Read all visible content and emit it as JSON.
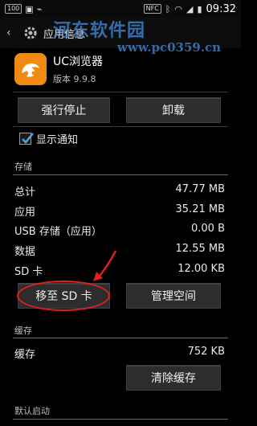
{
  "status_bar": {
    "left_badge": "100",
    "nfc": "NFC",
    "time": "09:32"
  },
  "watermark": {
    "text": "河东软件园",
    "url": "www.pc0359.cn"
  },
  "action_bar": {
    "title": "应用信息",
    "icons": [
      "back-icon",
      "settings-icon"
    ]
  },
  "app": {
    "name": "UC浏览器",
    "version": "版本 9.9.8",
    "icon": "uc-browser-icon",
    "icon_color": "#f08a12"
  },
  "buttons": {
    "force_stop": "强行停止",
    "uninstall": "卸载",
    "move_to_sd": "移至 SD 卡",
    "manage_space": "管理空间",
    "clear_cache": "清除缓存"
  },
  "notification": {
    "label": "显示通知",
    "checked": true
  },
  "storage": {
    "header": "存储",
    "rows": [
      {
        "label": "总计",
        "value": "47.77 MB"
      },
      {
        "label": "应用",
        "value": "35.21 MB"
      },
      {
        "label": "USB 存储（应用）",
        "value": "0.00 B"
      },
      {
        "label": "数据",
        "value": "12.55 MB"
      },
      {
        "label": "SD 卡",
        "value": "12.00 KB"
      }
    ]
  },
  "cache": {
    "header": "缓存",
    "rows": [
      {
        "label": "缓存",
        "value": "752 KB"
      }
    ]
  },
  "default_launch": {
    "header": "默认启动"
  },
  "colors": {
    "annotation": "#e02020",
    "watermark": "#468cdc"
  }
}
